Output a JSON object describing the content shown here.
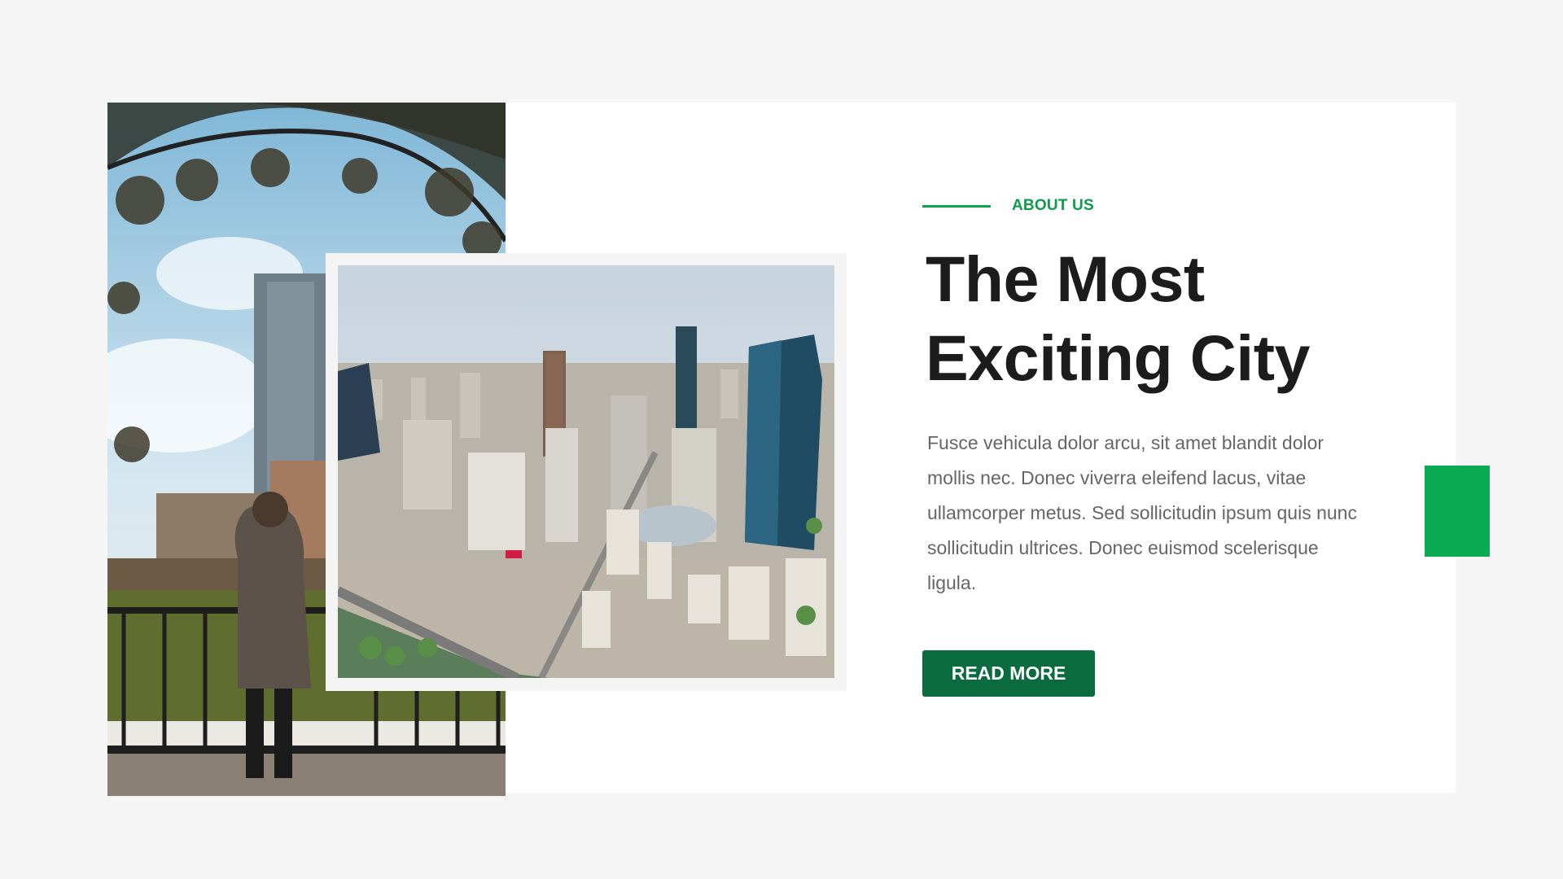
{
  "about": {
    "eyebrow": "ABOUT US",
    "title": "The Most Exciting City",
    "body": "Fusce vehicula dolor arcu, sit amet blandit dolor mollis nec. Donec viverra eleifend lacus, vitae ullamcorper metus. Sed sollicitudin ipsum quis nunc sollicitudin ultrices. Donec euismod scelerisque ligula.",
    "button_label": "READ MORE"
  },
  "images": {
    "left": "woman-overlooking-city-photo",
    "main": "aerial-city-skyline-photo"
  },
  "colors": {
    "accent": "#0bab53",
    "button": "#0a6b3f",
    "eyebrow": "#0f9b4c",
    "title": "#1c1c1c",
    "body": "#666666",
    "page_bg": "#f5f5f5",
    "card_bg": "#ffffff"
  }
}
